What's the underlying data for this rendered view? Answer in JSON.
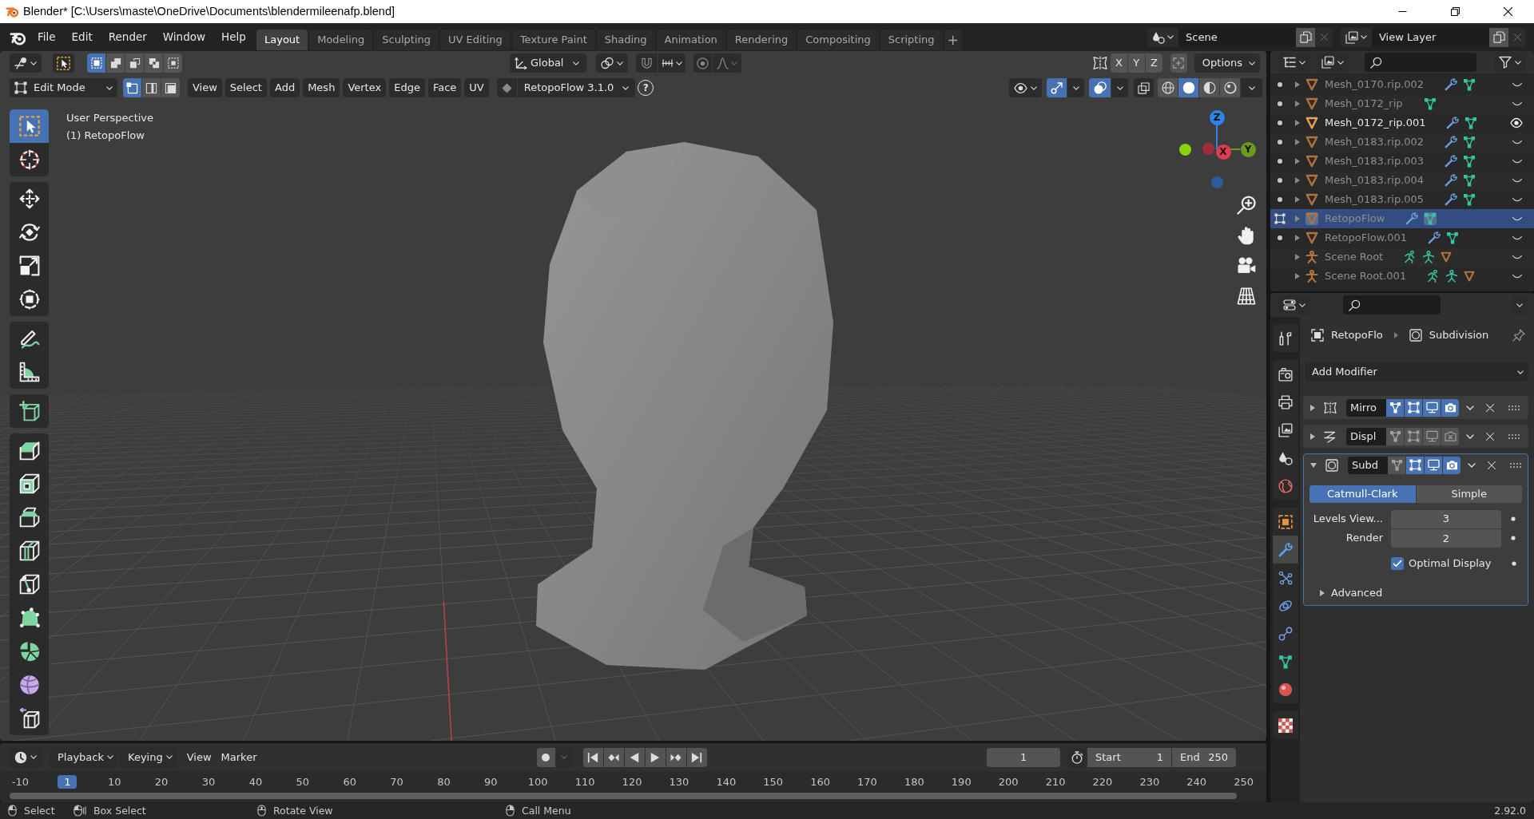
{
  "window": {
    "title": "Blender* [C:\\Users\\maste\\OneDrive\\Documents\\blendermileenafp.blend]"
  },
  "menus": [
    "File",
    "Edit",
    "Render",
    "Window",
    "Help"
  ],
  "workspaces": [
    {
      "label": "Layout",
      "selected": true
    },
    {
      "label": "Modeling",
      "selected": false
    },
    {
      "label": "Sculpting",
      "selected": false
    },
    {
      "label": "UV Editing",
      "selected": false
    },
    {
      "label": "Texture Paint",
      "selected": false
    },
    {
      "label": "Shading",
      "selected": false
    },
    {
      "label": "Animation",
      "selected": false
    },
    {
      "label": "Rendering",
      "selected": false
    },
    {
      "label": "Compositing",
      "selected": false
    },
    {
      "label": "Scripting",
      "selected": false
    }
  ],
  "add_workspace": "+",
  "scene": "Scene",
  "view_layer": "View Layer",
  "viewport": {
    "select_modes": [
      {
        "kind": "set",
        "selected": true
      },
      {
        "kind": "extend",
        "selected": false
      },
      {
        "kind": "subtract",
        "selected": false
      },
      {
        "kind": "invert",
        "selected": false
      },
      {
        "kind": "intersect",
        "selected": false
      }
    ],
    "orientation": "Global",
    "snap": {
      "on": false
    },
    "proportional_editing": {
      "on": false
    },
    "mirror_axes": [
      {
        "label": "X",
        "selected": false
      },
      {
        "label": "Y",
        "selected": false
      },
      {
        "label": "Z",
        "selected": false
      }
    ],
    "options": "Options",
    "mode": "Edit Mode",
    "element_modes": [
      {
        "kind": "vertex",
        "selected": true
      },
      {
        "kind": "edge",
        "selected": false
      },
      {
        "kind": "face",
        "selected": false
      }
    ],
    "menus": [
      "View",
      "Select",
      "Add",
      "Mesh",
      "Vertex",
      "Edge",
      "Face",
      "UV"
    ],
    "addon": {
      "label": "RetopoFlow 3.1.0",
      "help": "?"
    },
    "gizmos": {
      "on": true
    },
    "overlays": {
      "on": true
    },
    "xray": {
      "on": false
    },
    "shading": [
      {
        "kind": "wireframe",
        "selected": false
      },
      {
        "kind": "solid",
        "selected": true
      },
      {
        "kind": "material",
        "selected": false
      },
      {
        "kind": "rendered",
        "selected": false
      }
    ],
    "info": [
      "User Perspective",
      "(1) RetopoFlow"
    ],
    "tool_groups": [
      [
        {
          "kind": "select_box",
          "selected": true
        },
        {
          "kind": "cursor",
          "selected": false
        }
      ],
      [
        {
          "kind": "move",
          "selected": false
        },
        {
          "kind": "rotate",
          "selected": false
        },
        {
          "kind": "scale",
          "selected": false
        },
        {
          "kind": "transform",
          "selected": false
        }
      ],
      [
        {
          "kind": "annotate",
          "selected": false
        },
        {
          "kind": "measure",
          "selected": false
        }
      ],
      [
        {
          "kind": "add_cube",
          "selected": false
        }
      ],
      [
        {
          "kind": "extrude",
          "selected": false
        },
        {
          "kind": "inset",
          "selected": false
        },
        {
          "kind": "bevel",
          "selected": false
        },
        {
          "kind": "loop_cut",
          "selected": false
        },
        {
          "kind": "knife",
          "selected": false
        },
        {
          "kind": "poly_build",
          "selected": false
        },
        {
          "kind": "spin",
          "selected": false
        },
        {
          "kind": "smooth",
          "selected": false
        },
        {
          "kind": "edge_slide",
          "selected": false
        }
      ]
    ],
    "gizmo_axes": [
      {
        "label": "Z",
        "color": "#2f83e6"
      },
      {
        "label": "X",
        "color": "#e23b50"
      },
      {
        "label": "Y",
        "color": "#6b9a1e"
      }
    ],
    "gizmo_dots": [
      {
        "color": "#8bd20a"
      },
      {
        "color": "#a12c3c"
      },
      {
        "color": "#2c5e9e"
      }
    ]
  },
  "outliner": {
    "rows": [
      {
        "name": "Mesh_0170.rip.002",
        "kind": "mesh",
        "edit_mode": false,
        "modifiers": true,
        "visible": false,
        "selected": false
      },
      {
        "name": "Mesh_0172_rip",
        "kind": "mesh",
        "edit_mode": false,
        "modifiers": false,
        "visible": false,
        "selected": false
      },
      {
        "name": "Mesh_0172_rip.001",
        "kind": "mesh",
        "edit_mode": false,
        "modifiers": true,
        "visible": true,
        "selected": false
      },
      {
        "name": "Mesh_0183.rip.002",
        "kind": "mesh",
        "edit_mode": false,
        "modifiers": true,
        "visible": false,
        "selected": false
      },
      {
        "name": "Mesh_0183.rip.003",
        "kind": "mesh",
        "edit_mode": false,
        "modifiers": true,
        "visible": false,
        "selected": false
      },
      {
        "name": "Mesh_0183.rip.004",
        "kind": "mesh",
        "edit_mode": false,
        "modifiers": true,
        "visible": false,
        "selected": false
      },
      {
        "name": "Mesh_0183.rip.005",
        "kind": "mesh",
        "edit_mode": false,
        "modifiers": true,
        "visible": false,
        "selected": false
      },
      {
        "name": "RetopoFlow",
        "kind": "mesh",
        "edit_mode": true,
        "modifiers": true,
        "visible": false,
        "selected": true
      },
      {
        "name": "RetopoFlow.001",
        "kind": "mesh",
        "edit_mode": false,
        "modifiers": true,
        "visible": false,
        "selected": false
      },
      {
        "name": "Scene Root",
        "kind": "armature",
        "edit_mode": false,
        "modifiers": false,
        "visible": false,
        "selected": false
      },
      {
        "name": "Scene Root.001",
        "kind": "armature",
        "edit_mode": false,
        "modifiers": false,
        "visible": false,
        "selected": false
      }
    ]
  },
  "properties": {
    "tab_groups": [
      [
        {
          "kind": "tool",
          "selected": false
        }
      ],
      [
        {
          "kind": "render",
          "selected": false
        },
        {
          "kind": "output",
          "selected": false
        },
        {
          "kind": "view_layer",
          "selected": false
        },
        {
          "kind": "scene",
          "selected": false
        },
        {
          "kind": "world",
          "selected": false
        }
      ],
      [
        {
          "kind": "object",
          "selected": false
        },
        {
          "kind": "modifiers",
          "selected": true
        },
        {
          "kind": "particles",
          "selected": false
        },
        {
          "kind": "physics",
          "selected": false
        },
        {
          "kind": "constraints",
          "selected": false
        },
        {
          "kind": "data",
          "selected": false
        },
        {
          "kind": "material",
          "selected": false
        }
      ],
      [
        {
          "kind": "texture",
          "selected": false
        }
      ]
    ],
    "breadcrumb": [
      {
        "kind": "object",
        "label": "RetopoFlo"
      },
      {
        "kind": "subdivision",
        "label": "Subdivision"
      }
    ],
    "add_modifier": "Add Modifier",
    "modifiers": [
      {
        "name": "Mirro",
        "kind": "mirror",
        "expanded": false,
        "active": false,
        "toggles": [
          {
            "kind": "edit_mode",
            "on": true
          },
          {
            "kind": "on_cage",
            "on": true
          },
          {
            "kind": "viewport",
            "on": true
          },
          {
            "kind": "render",
            "on": true
          }
        ]
      },
      {
        "name": "Displ",
        "kind": "displace",
        "expanded": false,
        "active": false,
        "toggles": [
          {
            "kind": "edit_mode",
            "on": false
          },
          {
            "kind": "on_cage",
            "on": false
          },
          {
            "kind": "viewport",
            "on": false
          },
          {
            "kind": "render",
            "on": false
          }
        ]
      },
      {
        "name": "Subd",
        "kind": "subdivision",
        "expanded": true,
        "active": true,
        "toggles": [
          {
            "kind": "edit_mode",
            "on": false
          },
          {
            "kind": "on_cage",
            "on": true
          },
          {
            "kind": "viewport",
            "on": true
          },
          {
            "kind": "render",
            "on": true
          }
        ],
        "algorithm": [
          {
            "label": "Catmull-Clark",
            "selected": true
          },
          {
            "label": "Simple",
            "selected": false
          }
        ],
        "fields": [
          {
            "label": "Levels View...",
            "value": "3"
          },
          {
            "label": "Render",
            "value": "2"
          }
        ],
        "optimal_display": {
          "label": "Optimal Display",
          "checked": true
        },
        "advanced": {
          "label": "Advanced",
          "expanded": false
        }
      }
    ]
  },
  "timeline": {
    "dropdowns": [
      "Playback",
      "Keying"
    ],
    "menus": [
      "View",
      "Marker"
    ],
    "current_frame": "1",
    "start": {
      "label": "Start",
      "value": "1"
    },
    "end": {
      "label": "End",
      "value": "250"
    },
    "ruler": [
      {
        "label": "-10",
        "current": false
      },
      {
        "label": "1",
        "current": true
      },
      {
        "label": "10",
        "current": false
      },
      {
        "label": "20",
        "current": false
      },
      {
        "label": "30",
        "current": false
      },
      {
        "label": "40",
        "current": false
      },
      {
        "label": "50",
        "current": false
      },
      {
        "label": "60",
        "current": false
      },
      {
        "label": "70",
        "current": false
      },
      {
        "label": "80",
        "current": false
      },
      {
        "label": "90",
        "current": false
      },
      {
        "label": "100",
        "current": false
      },
      {
        "label": "110",
        "current": false
      },
      {
        "label": "120",
        "current": false
      },
      {
        "label": "130",
        "current": false
      },
      {
        "label": "140",
        "current": false
      },
      {
        "label": "150",
        "current": false
      },
      {
        "label": "160",
        "current": false
      },
      {
        "label": "170",
        "current": false
      },
      {
        "label": "180",
        "current": false
      },
      {
        "label": "190",
        "current": false
      },
      {
        "label": "200",
        "current": false
      },
      {
        "label": "210",
        "current": false
      },
      {
        "label": "220",
        "current": false
      },
      {
        "label": "230",
        "current": false
      },
      {
        "label": "240",
        "current": false
      },
      {
        "label": "250",
        "current": false
      }
    ]
  },
  "status_bar": {
    "hints": [
      {
        "kind": "left_click",
        "label": "Select"
      },
      {
        "kind": "drag",
        "label": "Box Select"
      },
      {
        "kind": "middle_click",
        "label": "Rotate View"
      },
      {
        "kind": "right_click",
        "label": "Call Menu"
      }
    ],
    "version": "2.92.0"
  }
}
